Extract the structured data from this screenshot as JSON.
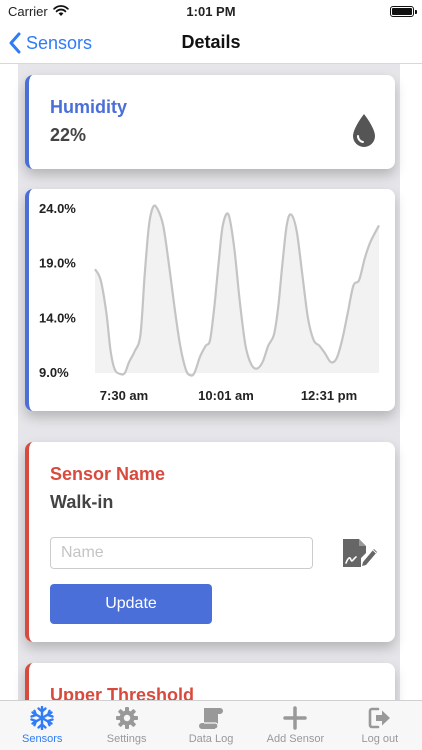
{
  "status_bar": {
    "carrier": "Carrier",
    "time": "1:01 PM"
  },
  "nav": {
    "back_label": "Sensors",
    "title": "Details"
  },
  "humidity_card": {
    "title": "Humidity",
    "value": "22%",
    "icon": "water-drop-icon",
    "accent": "#4a6fd8"
  },
  "chart_data": {
    "type": "area",
    "y_tick_labels": [
      "24.0%",
      "19.0%",
      "14.0%",
      "9.0%"
    ],
    "x_tick_labels": [
      "7:30 am",
      "10:01 am",
      "12:31 pm"
    ],
    "ylim": [
      9.0,
      24.0
    ],
    "xlim": [
      0,
      100
    ],
    "series": [
      {
        "x": [
          0,
          2,
          4,
          5.5,
          7,
          9,
          10.5,
          12,
          14,
          16,
          17.5,
          19,
          20.5,
          22,
          24,
          26,
          28,
          30,
          32,
          33.5,
          35,
          37,
          39,
          40.5,
          42,
          43.5,
          45,
          47,
          49,
          51,
          53,
          55,
          57,
          59,
          61,
          63,
          64.5,
          66,
          67.5,
          69,
          71,
          73,
          75,
          77,
          79,
          81,
          83,
          85,
          87,
          89,
          91,
          93,
          95,
          97,
          100
        ],
        "y": [
          18.5,
          17.5,
          14.5,
          11.0,
          9.3,
          8.9,
          9.0,
          10.0,
          11.0,
          12.5,
          18.0,
          22.5,
          24.2,
          24.0,
          22.5,
          19.0,
          15.0,
          11.5,
          9.3,
          8.8,
          9.0,
          10.5,
          11.5,
          12.0,
          15.0,
          19.0,
          22.5,
          23.5,
          20.5,
          15.5,
          11.5,
          9.8,
          9.4,
          10.0,
          11.5,
          12.5,
          15.0,
          19.0,
          22.5,
          23.5,
          22.0,
          18.0,
          14.0,
          12.0,
          11.5,
          10.8,
          10.0,
          10.3,
          12.0,
          14.5,
          17.0,
          17.5,
          19.5,
          21.0,
          22.5
        ]
      }
    ],
    "line_color": "#c4c4c4",
    "fill_color": "#f2f2f2",
    "grid": false
  },
  "sensor_name_card": {
    "title": "Sensor Name",
    "value": "Walk-in",
    "input_placeholder": "Name",
    "input_value": "",
    "edit_icon": "signature-edit-icon",
    "update_label": "Update",
    "accent": "#d84a3d"
  },
  "threshold_card": {
    "title": "Upper Threshold"
  },
  "tab_bar": {
    "items": [
      {
        "label": "Sensors",
        "icon": "snowflake-icon",
        "active": true
      },
      {
        "label": "Settings",
        "icon": "gear-icon",
        "active": false
      },
      {
        "label": "Data Log",
        "icon": "scroll-icon",
        "active": false
      },
      {
        "label": "Add Sensor",
        "icon": "plus-icon",
        "active": false
      },
      {
        "label": "Log out",
        "icon": "logout-icon",
        "active": false
      }
    ],
    "active_color": "#2f7cf6",
    "inactive_color": "#999999"
  }
}
